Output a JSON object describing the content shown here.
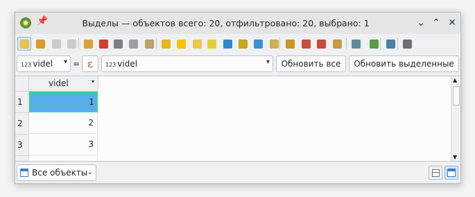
{
  "window": {
    "title": "Выделы — объектов всего: 20, отфильтровано: 20, выбрано: 1",
    "pin_glyph": "📌",
    "minimize_glyph": "⌄",
    "maximize_glyph": "⌃",
    "close_glyph": "✕"
  },
  "toolbar": {
    "buttons": [
      {
        "name": "toggle-editing-icon",
        "color": "#e8c34a",
        "active": true
      },
      {
        "name": "toggle-multi-edit-icon",
        "color": "#d99b2b"
      },
      {
        "name": "save-edits-icon",
        "color": "#c8cacc"
      },
      {
        "name": "reload-table-icon",
        "color": "#c8cacc"
      },
      {
        "name": "add-feature-icon",
        "color": "#d7a23c"
      },
      {
        "name": "delete-selected-icon",
        "color": "#d53b2c"
      },
      {
        "name": "cut-icon",
        "color": "#7c7f82"
      },
      {
        "name": "copy-icon",
        "color": "#9c9fa2"
      },
      {
        "name": "paste-icon",
        "color": "#b9a36a"
      },
      {
        "name": "select-by-expression-icon",
        "color": "#e6b81e"
      },
      {
        "name": "select-all-icon",
        "color": "#f0c400"
      },
      {
        "name": "invert-selection-icon",
        "color": "#e8c84a"
      },
      {
        "name": "deselect-all-icon",
        "color": "#e2cf3a"
      },
      {
        "name": "filter-select-icon",
        "color": "#2f86c9"
      },
      {
        "name": "move-selection-to-top-icon",
        "color": "#c9a21e"
      },
      {
        "name": "pan-to-selected-icon",
        "color": "#3e8fd1"
      },
      {
        "name": "zoom-to-selected-icon",
        "color": "#cdb054"
      },
      {
        "name": "copy-selected-rows-icon",
        "color": "#c99623"
      },
      {
        "name": "paste-features-icon",
        "color": "#c94d3d"
      },
      {
        "name": "delete-field-icon",
        "color": "#c64a3a"
      },
      {
        "name": "new-field-icon",
        "color": "#c79a3a"
      },
      {
        "name": "field-calculator-icon",
        "color": "#5d8a9c"
      },
      {
        "name": "conditional-formatting-icon",
        "color": "#5b9a4a"
      },
      {
        "name": "zoom-map-icon",
        "color": "#4a7fa8"
      },
      {
        "name": "dock-icon",
        "color": "#6d7174"
      }
    ]
  },
  "filter": {
    "field_type_badge": "123",
    "field_combo_value": "videl",
    "equals_label": "=",
    "expression_symbol": "ε",
    "value_type_badge": "123",
    "value_input": "videl",
    "dropdown_glyph": "▾",
    "update_all_label": "Обновить все",
    "update_selected_label": "Обновить выделенные"
  },
  "table": {
    "column_header": "videl",
    "sort_glyph": "▾",
    "rows": [
      {
        "row_number": "1",
        "value": "1",
        "selected": true
      },
      {
        "row_number": "2",
        "value": "2"
      },
      {
        "row_number": "3",
        "value": "3"
      }
    ]
  },
  "bottom": {
    "filter_mode_label": "Все объекты",
    "filter_mode_glyph": "⌄"
  },
  "colors": {
    "selection_fill": "#58aee8",
    "selection_border": "#3ecfa0"
  }
}
